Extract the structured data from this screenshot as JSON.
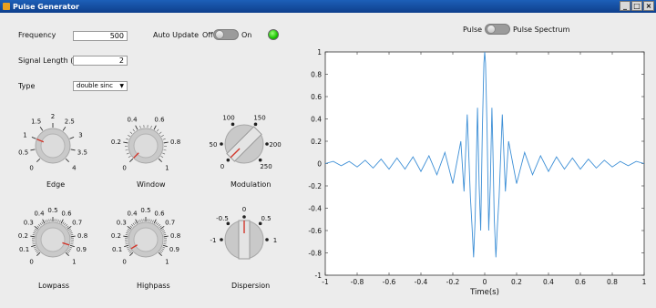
{
  "window": {
    "title": "Pulse Generator",
    "minimize": "_",
    "maximize": "□",
    "close": "×"
  },
  "frequency": {
    "label": "Frequency",
    "value": "500"
  },
  "signal_length": {
    "label": "Signal Length (s)",
    "value": "2"
  },
  "type": {
    "label": "Type",
    "value": "double sinc"
  },
  "auto_update": {
    "label": "Auto Update",
    "off": "Off",
    "on": "On",
    "state": "off"
  },
  "lamp": {
    "state": "on",
    "color": "#19c400"
  },
  "view_switch": {
    "left": "Pulse",
    "right": "Pulse Spectrum",
    "state": "Pulse"
  },
  "knobs": {
    "edge": {
      "label": "Edge",
      "ticks": [
        "0",
        "0.5",
        "1",
        "1.5",
        "2",
        "2.5",
        "3",
        "3.5",
        "4"
      ],
      "value": 1
    },
    "window": {
      "label": "Window",
      "ticks": [
        "0",
        "0.2",
        "0.4",
        "0.6",
        "0.8",
        "1"
      ],
      "value": 0
    },
    "lowpass": {
      "label": "Lowpass",
      "ticks": [
        "0",
        "0.1",
        "0.2",
        "0.3",
        "0.4",
        "0.5",
        "0.6",
        "0.7",
        "0.8",
        "0.9",
        "1"
      ],
      "value": 0.9
    },
    "highpass": {
      "label": "Highpass",
      "ticks": [
        "0",
        "0.1",
        "0.2",
        "0.3",
        "0.4",
        "0.5",
        "0.6",
        "0.7",
        "0.8",
        "0.9",
        "1"
      ],
      "value": 0.05
    }
  },
  "switches": {
    "modulation": {
      "label": "Modulation",
      "positions": [
        "0",
        "50",
        "100",
        "150",
        "200",
        "250"
      ],
      "value": "0"
    },
    "dispersion": {
      "label": "Dispersion",
      "positions": [
        "-1",
        "-0.5",
        "0",
        "0.5",
        "1"
      ],
      "value": "0"
    }
  },
  "chart_data": {
    "type": "line",
    "title": "",
    "xlabel": "Time(s)",
    "ylabel": "",
    "xlim": [
      -1,
      1
    ],
    "ylim": [
      -1,
      1
    ],
    "xticks": [
      "-1",
      "-0.8",
      "-0.6",
      "-0.4",
      "-0.2",
      "0",
      "0.2",
      "0.4",
      "0.6",
      "0.8",
      "1"
    ],
    "yticks": [
      "1",
      "0.8",
      "0.6",
      "0.4",
      "0.2",
      "0",
      "-0.2",
      "-0.4",
      "-0.6",
      "-0.8",
      "-1"
    ],
    "series": [
      {
        "color": "#3d8fd6",
        "x": [
          -1,
          -0.95,
          -0.9,
          -0.85,
          -0.8,
          -0.75,
          -0.7,
          -0.65,
          -0.6,
          -0.55,
          -0.5,
          -0.45,
          -0.4,
          -0.35,
          -0.3,
          -0.25,
          -0.2,
          -0.15,
          -0.13,
          -0.11,
          -0.09,
          -0.08,
          -0.07,
          -0.06,
          -0.05,
          -0.045,
          -0.035,
          -0.025,
          -0.015,
          -0.005,
          0,
          0.005,
          0.015,
          0.025,
          0.035,
          0.045,
          0.05,
          0.06,
          0.07,
          0.08,
          0.09,
          0.11,
          0.13,
          0.15,
          0.2,
          0.25,
          0.3,
          0.35,
          0.4,
          0.45,
          0.5,
          0.55,
          0.6,
          0.65,
          0.7,
          0.75,
          0.8,
          0.85,
          0.9,
          0.95,
          1
        ],
        "y": [
          0,
          0.02,
          -0.02,
          0.02,
          -0.03,
          0.03,
          -0.04,
          0.04,
          -0.05,
          0.05,
          -0.05,
          0.06,
          -0.07,
          0.07,
          -0.1,
          0.1,
          -0.18,
          0.2,
          -0.25,
          0.44,
          -0.3,
          -0.55,
          -0.84,
          -0.5,
          0.2,
          0.5,
          -0.2,
          -0.6,
          0.3,
          0.9,
          1,
          0.9,
          0.3,
          -0.6,
          -0.2,
          0.5,
          0.2,
          -0.5,
          -0.84,
          -0.55,
          -0.3,
          0.44,
          -0.25,
          0.2,
          -0.18,
          0.1,
          -0.1,
          0.07,
          -0.07,
          0.06,
          -0.05,
          0.05,
          -0.05,
          0.04,
          -0.04,
          0.03,
          -0.03,
          0.02,
          -0.02,
          0.02,
          0
        ]
      }
    ]
  }
}
